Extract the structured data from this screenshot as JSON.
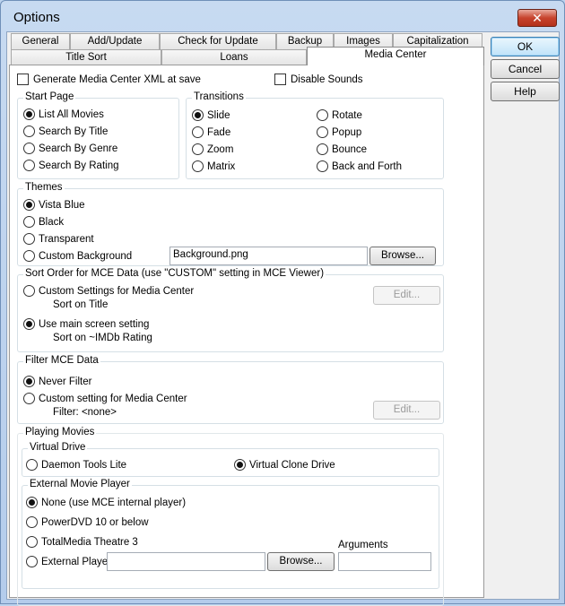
{
  "window": {
    "title": "Options",
    "close_label": "✕"
  },
  "tabs": {
    "row1": [
      "General",
      "Add/Update",
      "Check for Update",
      "Backup",
      "Images",
      "Capitalization"
    ],
    "row2": [
      "Title Sort",
      "Loans",
      "Media Center"
    ],
    "active": "Media Center"
  },
  "buttons": {
    "ok": "OK",
    "cancel": "Cancel",
    "help": "Help"
  },
  "top_options": {
    "generate_xml": "Generate Media Center XML at save",
    "disable_sounds": "Disable Sounds"
  },
  "start_page": {
    "title": "Start Page",
    "options": [
      "List All Movies",
      "Search By Title",
      "Search By Genre",
      "Search By Rating"
    ],
    "selected": "List All Movies"
  },
  "transitions": {
    "title": "Transitions",
    "left": [
      "Slide",
      "Fade",
      "Zoom",
      "Matrix"
    ],
    "right": [
      "Rotate",
      "Popup",
      "Bounce",
      "Back and Forth"
    ],
    "selected": "Slide"
  },
  "themes": {
    "title": "Themes",
    "options": [
      "Vista Blue",
      "Black",
      "Transparent",
      "Custom Background"
    ],
    "selected": "Vista Blue",
    "background_value": "Background.png",
    "browse": "Browse..."
  },
  "sort_order": {
    "title": "Sort Order for MCE Data (use \"CUSTOM\" setting in MCE Viewer)",
    "custom_label": "Custom Settings for Media Center",
    "custom_sub": "Sort on Title",
    "main_label": "Use main screen setting",
    "main_sub": "Sort on ~IMDb Rating",
    "edit": "Edit..."
  },
  "filter": {
    "title": "Filter MCE Data",
    "never": "Never Filter",
    "custom": "Custom setting for Media Center",
    "custom_sub": "Filter: <none>",
    "edit": "Edit..."
  },
  "playing": {
    "title": "Playing Movies",
    "virtual_drive": {
      "title": "Virtual Drive",
      "daemon": "Daemon Tools Lite",
      "clone": "Virtual Clone Drive"
    },
    "external": {
      "title": "External Movie Player",
      "options": [
        "None (use MCE internal player)",
        "PowerDVD 10 or below",
        "TotalMedia Theatre 3",
        "External Player:"
      ],
      "selected": "None (use MCE internal player)",
      "player_value": "",
      "browse": "Browse...",
      "arguments_label": "Arguments",
      "arguments_value": ""
    }
  }
}
